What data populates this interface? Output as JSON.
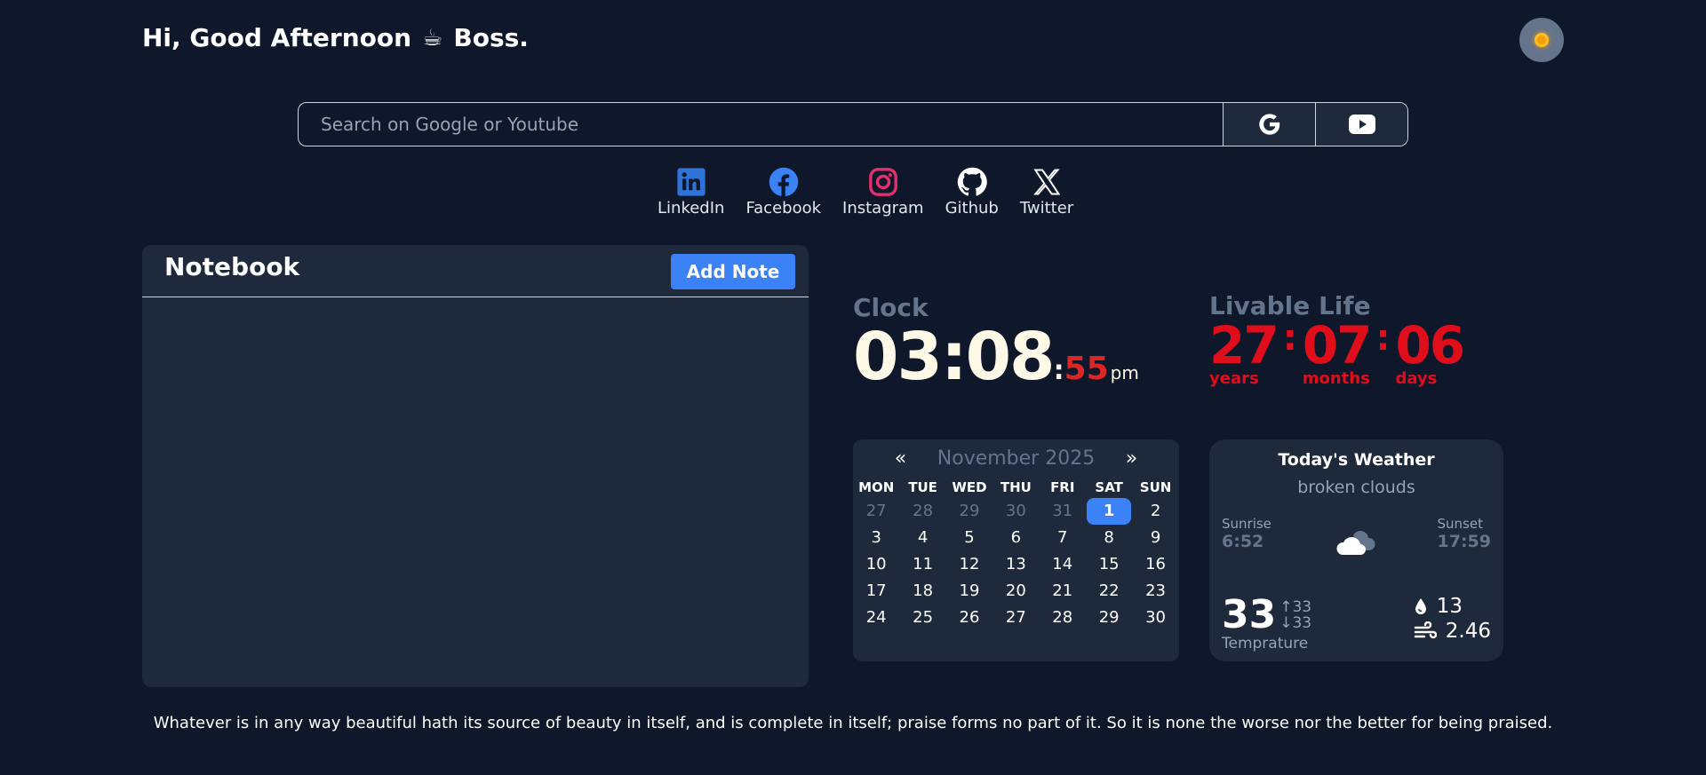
{
  "header": {
    "greeting": "Hi, Good Afternoon",
    "greeting_icon": "☕",
    "name": "Boss.",
    "theme_toggle_icon": "sun-icon"
  },
  "search": {
    "placeholder": "Search on Google or Youtube",
    "buttons": [
      "google-icon",
      "youtube-icon"
    ]
  },
  "socials": [
    {
      "label": "LinkedIn",
      "icon": "linkedin-icon",
      "color": "#2f73d9"
    },
    {
      "label": "Facebook",
      "icon": "facebook-icon",
      "color": "#3b82f6"
    },
    {
      "label": "Instagram",
      "icon": "instagram-icon",
      "color": "#e1306c"
    },
    {
      "label": "Github",
      "icon": "github-icon",
      "color": "#ffffff"
    },
    {
      "label": "Twitter",
      "icon": "x-twitter-icon",
      "color": "#ffffff"
    }
  ],
  "notebook": {
    "title": "Notebook",
    "add_label": "Add Note"
  },
  "clock": {
    "label": "Clock",
    "hours_minutes": "03:08",
    "separator": ":",
    "seconds": "55",
    "ampm": "pm"
  },
  "livable": {
    "label": "Livable Life",
    "years": "27",
    "years_label": "years",
    "months": "07",
    "months_label": "months",
    "days": "06",
    "days_label": "days",
    "separator": ":"
  },
  "calendar": {
    "prev": "«",
    "next": "»",
    "month": "November 2025",
    "weekdays": [
      "MON",
      "TUE",
      "WED",
      "THU",
      "FRI",
      "SAT",
      "SUN"
    ],
    "days": [
      {
        "d": "27",
        "muted": true
      },
      {
        "d": "28",
        "muted": true
      },
      {
        "d": "29",
        "muted": true
      },
      {
        "d": "30",
        "muted": true
      },
      {
        "d": "31",
        "muted": true
      },
      {
        "d": "1",
        "today": true
      },
      {
        "d": "2"
      },
      {
        "d": "3"
      },
      {
        "d": "4"
      },
      {
        "d": "5"
      },
      {
        "d": "6"
      },
      {
        "d": "7"
      },
      {
        "d": "8"
      },
      {
        "d": "9"
      },
      {
        "d": "10"
      },
      {
        "d": "11"
      },
      {
        "d": "12"
      },
      {
        "d": "13"
      },
      {
        "d": "14"
      },
      {
        "d": "15"
      },
      {
        "d": "16"
      },
      {
        "d": "17"
      },
      {
        "d": "18"
      },
      {
        "d": "19"
      },
      {
        "d": "20"
      },
      {
        "d": "21"
      },
      {
        "d": "22"
      },
      {
        "d": "23"
      },
      {
        "d": "24"
      },
      {
        "d": "25"
      },
      {
        "d": "26"
      },
      {
        "d": "27"
      },
      {
        "d": "28"
      },
      {
        "d": "29"
      },
      {
        "d": "30"
      }
    ]
  },
  "weather": {
    "title": "Today's Weather",
    "description": "broken clouds",
    "sunrise_label": "Sunrise",
    "sunrise": "6:52",
    "sunset_label": "Sunset",
    "sunset": "17:59",
    "temp": "33",
    "temp_max": "33",
    "temp_min": "33",
    "temp_label": "Temprature",
    "humidity": "13",
    "wind": "2.46"
  },
  "quote": "Whatever is in any way beautiful hath its source of beauty in itself, and is complete in itself; praise forms no part of it. So it is none the worse nor the better for being praised."
}
